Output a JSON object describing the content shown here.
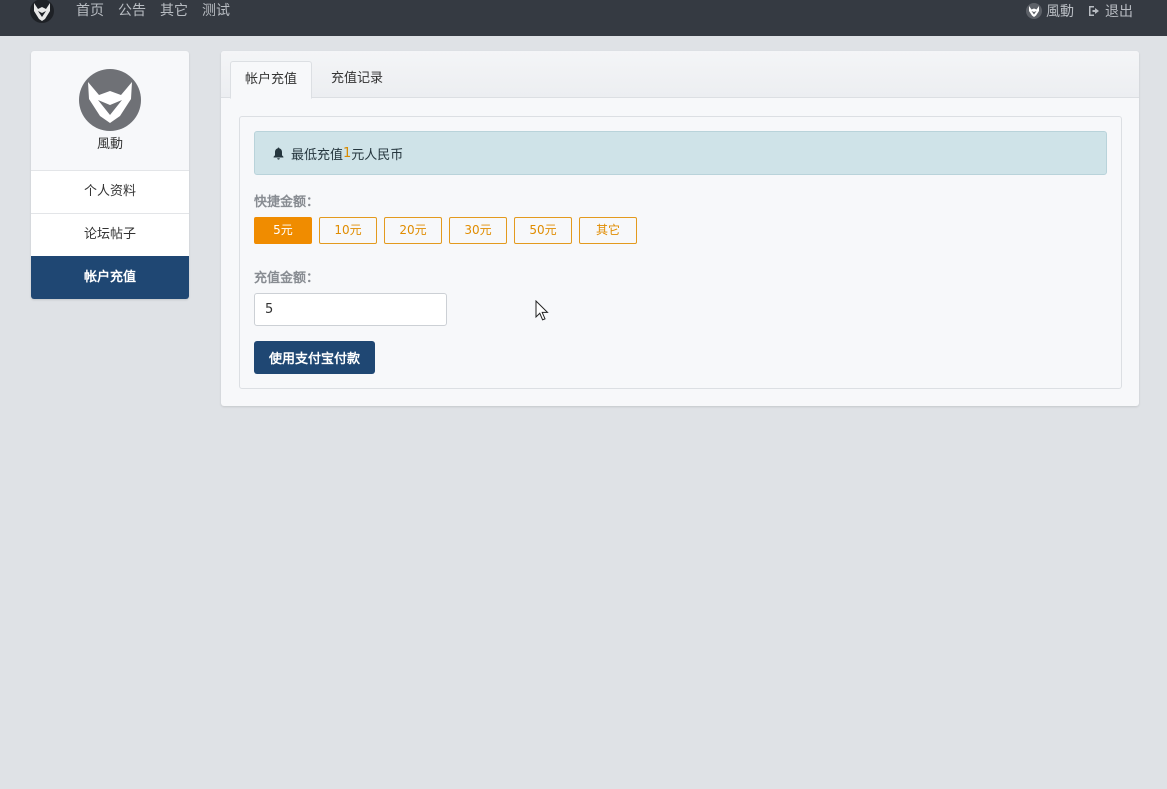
{
  "navbar": {
    "links": [
      "首页",
      "公告",
      "其它",
      "测试"
    ],
    "user_name": "風動",
    "logout_label": "退出"
  },
  "sidebar": {
    "profile_name": "風動",
    "items": [
      {
        "label": "个人资料"
      },
      {
        "label": "论坛帖子"
      },
      {
        "label": "帐户充值"
      }
    ]
  },
  "tabs": [
    {
      "label": "帐户充值"
    },
    {
      "label": "充值记录"
    }
  ],
  "alert": {
    "prefix": "最低充值",
    "amount": "1",
    "suffix": "元人民币"
  },
  "quick": {
    "label": "快捷金额：",
    "options": [
      "5元",
      "10元",
      "20元",
      "30元",
      "50元",
      "其它"
    ],
    "selected": "5元"
  },
  "amount": {
    "label": "充值金额：",
    "value": "5"
  },
  "pay_button_label": "使用支付宝付款",
  "colors": {
    "navbar": "#353a42",
    "primary": "#1f4773",
    "accent": "#f08c00",
    "alert_bg": "#cfe3e8"
  }
}
